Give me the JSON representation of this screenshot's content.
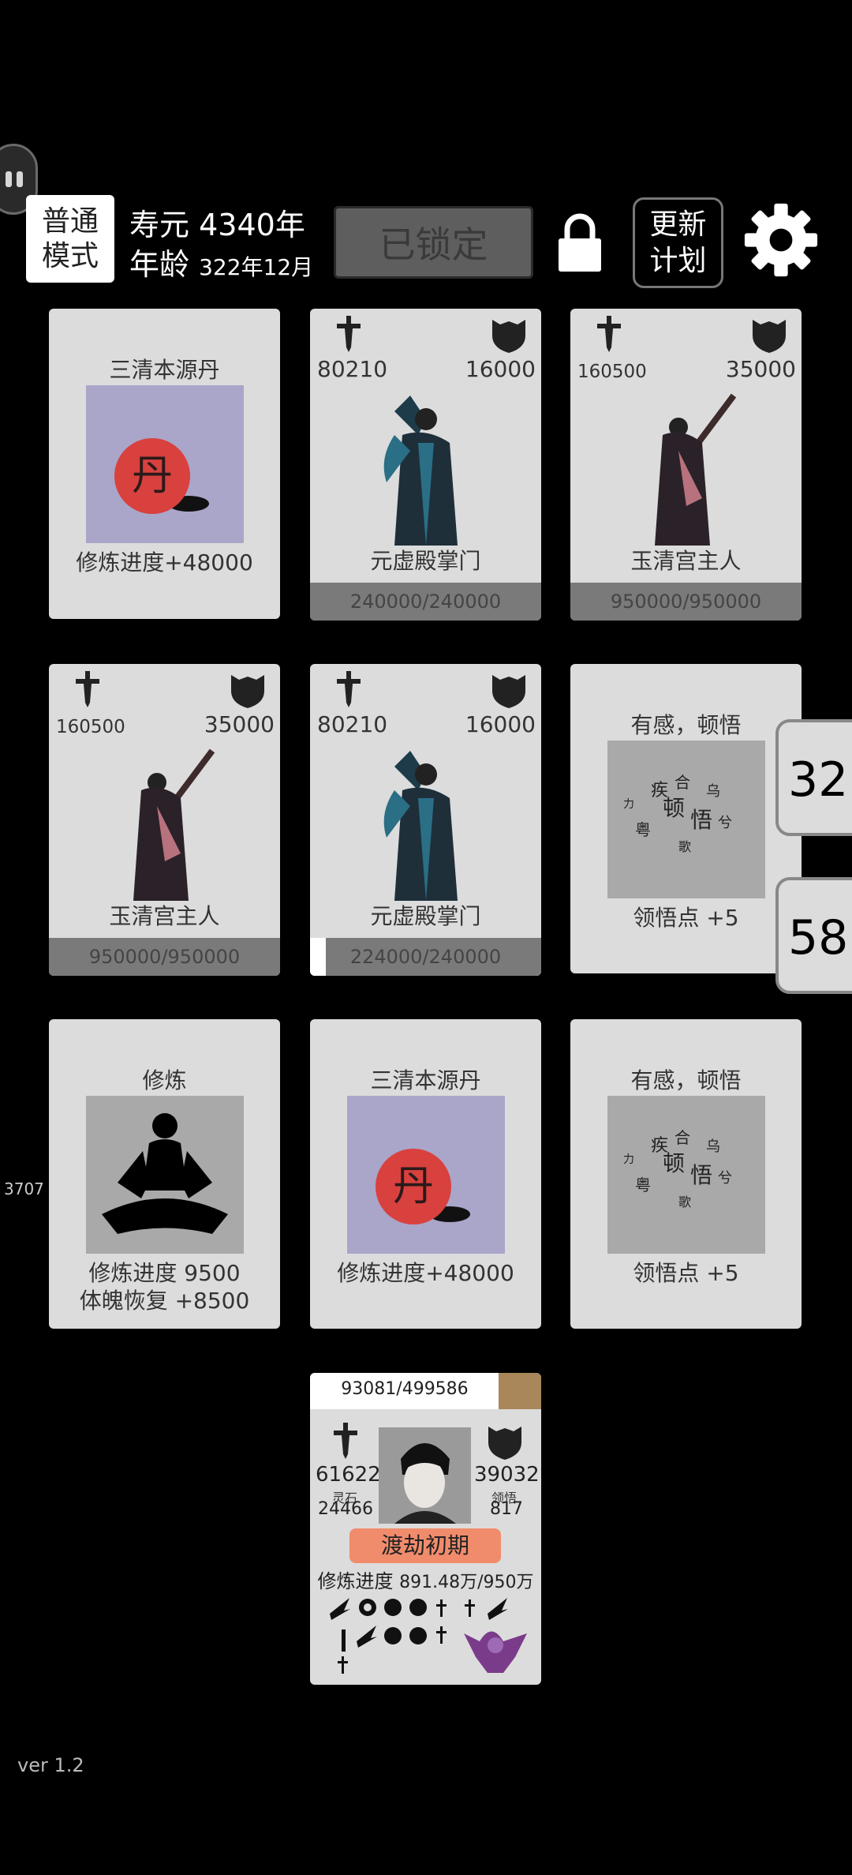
{
  "header": {
    "mode_line1": "普通",
    "mode_line2": "模式",
    "lifespan_label": "寿元",
    "lifespan_value": "4340年",
    "age_label": "年龄",
    "age_value": "322年12月",
    "locked_label": "已锁定",
    "plan_line1": "更新",
    "plan_line2": "计划"
  },
  "cards": {
    "c1": {
      "title": "三清本源丹",
      "desc": "修炼进度+48000",
      "icon": "pill-icon"
    },
    "c2": {
      "atk": "80210",
      "def": "16000",
      "name": "元虚殿掌门",
      "hp": "240000/240000",
      "hp_fraction": 1.0
    },
    "c3": {
      "atk": "160500",
      "def": "35000",
      "name": "玉清宫主人",
      "hp": "950000/950000",
      "hp_fraction": 1.0
    },
    "c4": {
      "atk": "160500",
      "def": "35000",
      "name": "玉清宫主人",
      "hp": "950000/950000",
      "hp_fraction": 1.0
    },
    "c5": {
      "atk": "80210",
      "def": "16000",
      "name": "元虚殿掌门",
      "hp": "224000/240000",
      "hp_fraction": 0.933
    },
    "c6": {
      "title": "有感，顿悟",
      "desc": "领悟点  +5",
      "icon": "enlightenment-icon"
    },
    "c7": {
      "title": "修炼",
      "desc1": "修炼进度  9500",
      "desc2": "体魄恢复  +8500",
      "icon": "meditation-icon"
    },
    "c8": {
      "title": "三清本源丹",
      "desc": "修炼进度+48000",
      "icon": "pill-icon"
    },
    "c9": {
      "title": "有感，顿悟",
      "desc": "领悟点  +5",
      "icon": "enlightenment-icon"
    }
  },
  "side": {
    "badge1": "32",
    "badge2": "58",
    "left_number": "3707"
  },
  "player": {
    "hp": "93081/499586",
    "hp_fraction": 0.186,
    "atk": "61622",
    "def": "39032",
    "stone_label": "灵石",
    "stone_value": "24466",
    "insight_label": "领悟",
    "insight_value": "817",
    "realm": "渡劫初期",
    "progress_label": "修炼进度",
    "progress_value": "891.48万/950万"
  },
  "version": "ver 1.2",
  "colors": {
    "background": "#000000",
    "card": "#dcdcdc",
    "hpbar": "#7a7a7a",
    "realm_badge": "#f08c6c",
    "pill_bg": "#a9a6c9"
  }
}
